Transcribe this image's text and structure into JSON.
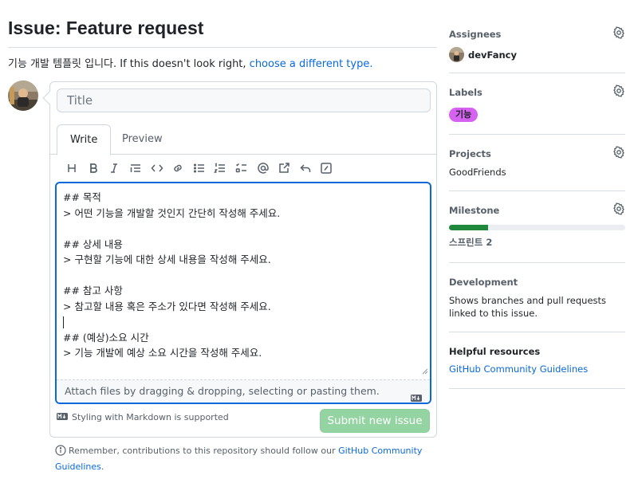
{
  "page": {
    "title": "Issue: Feature request",
    "template_note": "기능 개발 템플릿 입니다. If this doesn't look right, ",
    "template_link": "choose a different type."
  },
  "compose": {
    "title_placeholder": "Title",
    "tabs": [
      {
        "label": "Write",
        "active": true
      },
      {
        "label": "Preview",
        "active": false
      }
    ],
    "toolbar": [
      {
        "name": "heading-icon"
      },
      {
        "name": "bold-icon"
      },
      {
        "name": "italic-icon"
      },
      {
        "name": "quote-icon"
      },
      {
        "name": "code-icon"
      },
      {
        "name": "link-icon"
      },
      {
        "name": "bulleted-list-icon"
      },
      {
        "name": "numbered-list-icon"
      },
      {
        "name": "task-list-icon"
      },
      {
        "name": "mention-icon"
      },
      {
        "name": "cross-reference-icon"
      },
      {
        "name": "reply-icon"
      },
      {
        "name": "slash-commands-icon"
      }
    ],
    "body_lines": [
      "## 목적",
      "> 어떤 기능을 개발할 것인지 간단히 작성해 주세요.",
      "",
      "## 상세 내용",
      "> 구현할 기능에 대한 상세 내용을 작성해 주세요.",
      "",
      "## 참고 사항",
      "> 참고할 내용 혹은 주소가 있다면 작성해 주세요.",
      "",
      "## (예상)소요 시간",
      "> 기능 개발에 예상 소요 시간을 작성해 주세요."
    ],
    "attach_text": "Attach files by dragging & dropping, selecting or pasting them.",
    "markdown_note": "Styling with Markdown is supported",
    "submit_label": "Submit new issue"
  },
  "remember": {
    "text": "Remember, contributions to this repository should follow our ",
    "link": "GitHub Community Guidelines",
    "suffix": "."
  },
  "sidebar": {
    "assignees": {
      "heading": "Assignees",
      "user": "devFancy"
    },
    "labels": {
      "heading": "Labels",
      "label": "기능",
      "label_color": "#d562f0"
    },
    "projects": {
      "heading": "Projects",
      "value": "GoodFriends"
    },
    "milestone": {
      "heading": "Milestone",
      "progress_fraction": 0.22,
      "name": "스프린트 2"
    },
    "development": {
      "heading": "Development",
      "text": "Shows branches and pull requests linked to this issue."
    },
    "resources": {
      "heading": "Helpful resources",
      "link": "GitHub Community Guidelines"
    }
  },
  "colors": {
    "link": "#0969da",
    "submit_disabled": "#94d3a2",
    "progress": "#1f883d",
    "focus_border": "#0969da"
  }
}
